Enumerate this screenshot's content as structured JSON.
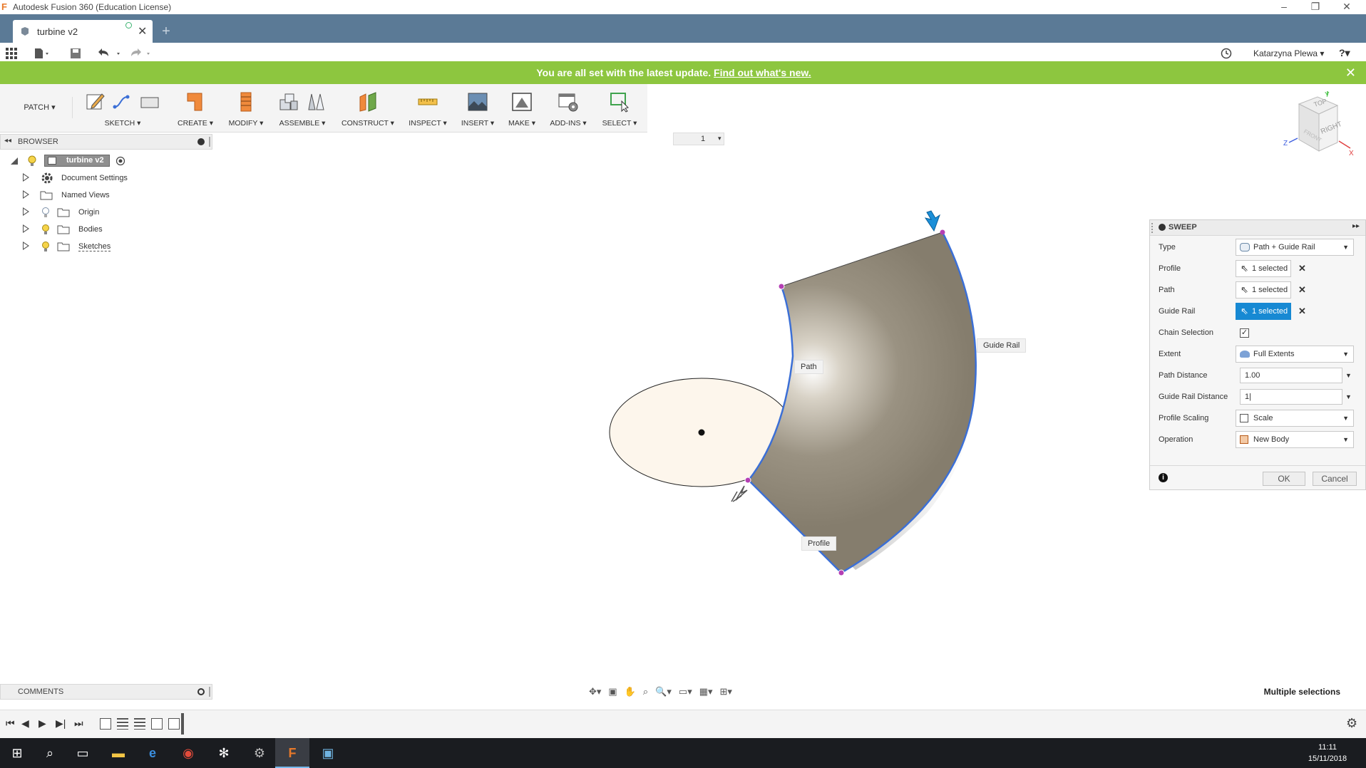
{
  "window": {
    "title": "Autodesk Fusion 360 (Education License)",
    "logo_letter": "F",
    "minimize": "–",
    "restore": "❐",
    "close": "✕"
  },
  "tabs": [
    {
      "label": "turbine v2",
      "close": "✕"
    }
  ],
  "new_tab": "+",
  "user": {
    "name": "Katarzyna Plewa ▾",
    "help": "?▾"
  },
  "banner": {
    "message": "You are all set with the latest update.",
    "link": "Find out what's new.",
    "close": "✕"
  },
  "toolbar": {
    "workspace": "PATCH ▾",
    "groups": [
      {
        "label": "SKETCH ▾"
      },
      {
        "label": "CREATE ▾"
      },
      {
        "label": "MODIFY ▾"
      },
      {
        "label": "ASSEMBLE ▾"
      },
      {
        "label": "CONSTRUCT ▾"
      },
      {
        "label": "INSPECT ▾"
      },
      {
        "label": "INSERT ▾"
      },
      {
        "label": "MAKE ▾"
      },
      {
        "label": "ADD-INS ▾"
      },
      {
        "label": "SELECT ▾"
      }
    ]
  },
  "timeline_marker": {
    "value": "1",
    "arrow": "▾"
  },
  "browser": {
    "title": "BROWSER",
    "root": "turbine v2",
    "items": [
      {
        "label": "Document Settings"
      },
      {
        "label": "Named Views"
      },
      {
        "label": "Origin"
      },
      {
        "label": "Bodies"
      },
      {
        "label": "Sketches"
      }
    ]
  },
  "viewcube": {
    "top": "TOP",
    "right": "RIGHT",
    "front": "FRONT",
    "axis_x": "X",
    "axis_y": "Y",
    "axis_z": "Z"
  },
  "canvas": {
    "label_path": "Path",
    "label_guide_rail": "Guide Rail",
    "label_profile": "Profile"
  },
  "sweep": {
    "title": "SWEEP",
    "rows": {
      "type": {
        "label": "Type",
        "value": "Path + Guide Rail"
      },
      "profile": {
        "label": "Profile",
        "value": "1 selected"
      },
      "path": {
        "label": "Path",
        "value": "1 selected"
      },
      "guide_rail": {
        "label": "Guide Rail",
        "value": "1 selected"
      },
      "chain": {
        "label": "Chain Selection",
        "checked": "✓"
      },
      "extent": {
        "label": "Extent",
        "value": "Full Extents"
      },
      "path_distance": {
        "label": "Path Distance",
        "value": "1.00"
      },
      "guide_rail_distance": {
        "label": "Guide Rail Distance",
        "value": "1|"
      },
      "profile_scaling": {
        "label": "Profile Scaling",
        "value": "Scale"
      },
      "operation": {
        "label": "Operation",
        "value": "New Body"
      }
    },
    "ok": "OK",
    "cancel": "Cancel",
    "info": "i"
  },
  "comments": {
    "title": "COMMENTS"
  },
  "status": {
    "text": "Multiple selections"
  },
  "clock": {
    "time": "11:11",
    "date": "15/11/2018"
  },
  "colors": {
    "tab_bar": "#5b7a96",
    "banner": "#8dc63f",
    "selection_blue": "#1789d3",
    "edge_blue": "#3b6fd6",
    "surface": "#8a8272",
    "profile_fill": "#fdf6ec"
  }
}
